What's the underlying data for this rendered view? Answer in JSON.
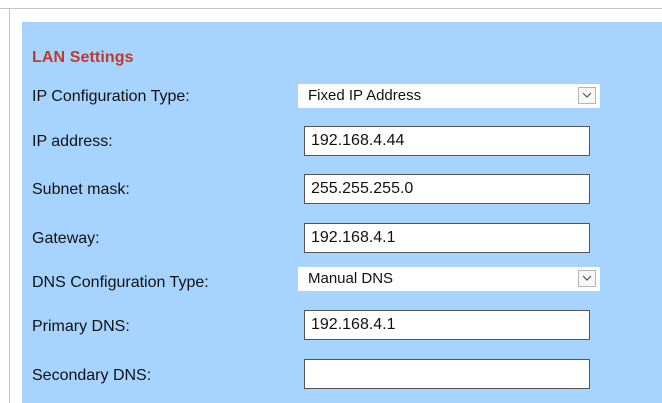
{
  "lan_settings": {
    "title": "LAN Settings",
    "ip_config": {
      "label": "IP Configuration Type:",
      "value": "Fixed IP Address",
      "arrow_icon": "chevron-down-icon"
    },
    "ip_address": {
      "label": "IP address:",
      "value": "192.168.4.44"
    },
    "subnet_mask": {
      "label": "Subnet mask:",
      "value": "255.255.255.0"
    },
    "gateway": {
      "label": "Gateway:",
      "value": "192.168.4.1"
    },
    "dns_config": {
      "label": "DNS Configuration Type:",
      "value": "Manual DNS",
      "arrow_icon": "chevron-down-icon"
    },
    "primary_dns": {
      "label": "Primary DNS:",
      "value": "192.168.4.1"
    },
    "secondary_dns": {
      "label": "Secondary DNS:",
      "value": ""
    }
  },
  "colors": {
    "panel_background": "#a7d3ff",
    "title_color": "#c0392b",
    "input_border": "#555555"
  }
}
